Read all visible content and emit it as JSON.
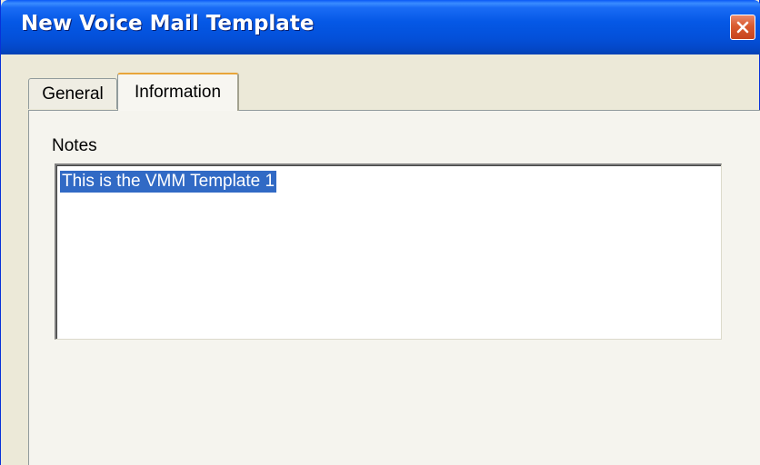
{
  "window": {
    "title": "New Voice Mail Template"
  },
  "tabs": [
    {
      "label": "General",
      "selected": false
    },
    {
      "label": "Information",
      "selected": true
    }
  ],
  "information": {
    "notes_label": "Notes",
    "notes_value": "This is the VMM Template 1",
    "notes_text_selected": true
  },
  "colors": {
    "titlebar": "#0558e6",
    "face": "#ece9d8",
    "selection": "#316ac5",
    "close_button": "#d95a2f",
    "active_tab_accent": "#e8a53a"
  },
  "icons": {
    "close": "close-x-icon"
  }
}
